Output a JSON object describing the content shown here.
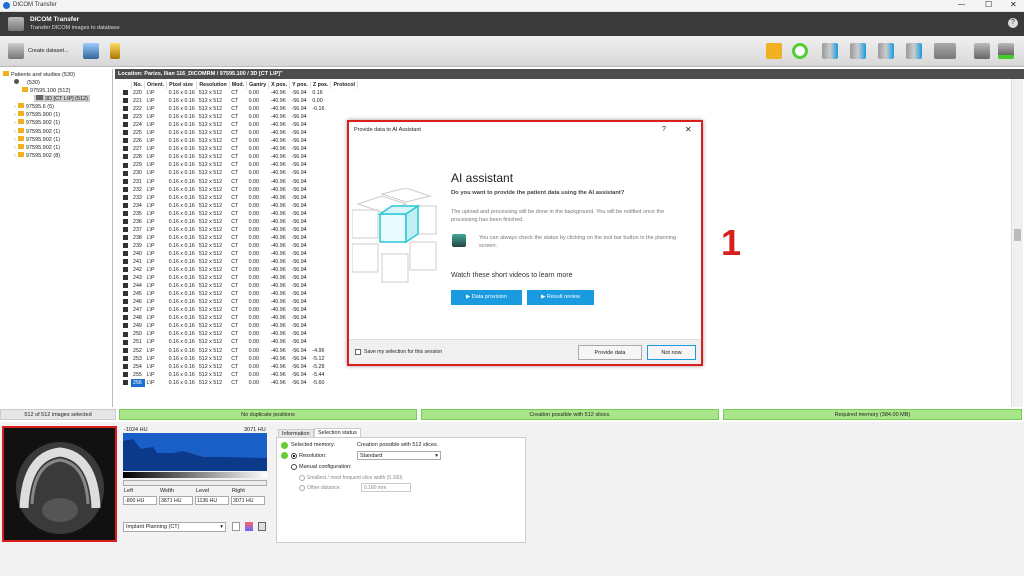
{
  "window": {
    "title": "DICOM Transfer"
  },
  "header": {
    "title": "DICOM Transfer",
    "subtitle": "Transfer DICOM images to database"
  },
  "toolbar": {
    "create_label": "Create dataset..."
  },
  "tree": {
    "root": "Patients and studies (530)",
    "patient": "(530)",
    "study": "97595.100 (512)",
    "series": "3D [CT L\\P] (512)",
    "others": [
      "97595.6 (5)",
      "97595.900 (1)",
      "97595.902 (1)",
      "97595.902 (1)",
      "97595.902 (1)",
      "97595.902 (1)",
      "97595.902 (8)"
    ]
  },
  "location": "Location: Parizo, Ilian 116_DICOMRM / 97595.100 / 3D [CT L\\P]\"",
  "table": {
    "headers": [
      "No.",
      "Orient.",
      "Pixel size",
      "Resolution",
      "Mod.",
      "Gantry",
      "X pos.",
      "Y pos.",
      "Z pos.",
      "Protocol"
    ],
    "rows": [
      [
        "220",
        "L\\P",
        "0.16 x 0.16",
        "512 x 512",
        "CT",
        "0.00",
        "-40.96",
        "-56.94",
        "0.16"
      ],
      [
        "221",
        "L\\P",
        "0.16 x 0.16",
        "512 x 512",
        "CT",
        "0.00",
        "-40.96",
        "-56.94",
        "0.00"
      ],
      [
        "222",
        "L\\P",
        "0.16 x 0.16",
        "512 x 512",
        "CT",
        "0.00",
        "-40.96",
        "-56.94",
        "-0.16"
      ],
      [
        "223",
        "L\\P",
        "0.16 x 0.16",
        "512 x 512",
        "CT",
        "0.00",
        "-40.96",
        "-56.94",
        ""
      ],
      [
        "224",
        "L\\P",
        "0.16 x 0.16",
        "512 x 512",
        "CT",
        "0.00",
        "-40.96",
        "-56.94",
        ""
      ],
      [
        "225",
        "L\\P",
        "0.16 x 0.16",
        "512 x 512",
        "CT",
        "0.00",
        "-40.96",
        "-56.94",
        ""
      ],
      [
        "226",
        "L\\P",
        "0.16 x 0.16",
        "512 x 512",
        "CT",
        "0.00",
        "-40.96",
        "-56.94",
        ""
      ],
      [
        "227",
        "L\\P",
        "0.16 x 0.16",
        "512 x 512",
        "CT",
        "0.00",
        "-40.96",
        "-56.94",
        ""
      ],
      [
        "228",
        "L\\P",
        "0.16 x 0.16",
        "512 x 512",
        "CT",
        "0.00",
        "-40.96",
        "-56.94",
        ""
      ],
      [
        "229",
        "L\\P",
        "0.16 x 0.16",
        "512 x 512",
        "CT",
        "0.00",
        "-40.96",
        "-56.94",
        ""
      ],
      [
        "230",
        "L\\P",
        "0.16 x 0.16",
        "512 x 512",
        "CT",
        "0.00",
        "-40.96",
        "-56.94",
        ""
      ],
      [
        "231",
        "L\\P",
        "0.16 x 0.16",
        "512 x 512",
        "CT",
        "0.00",
        "-40.96",
        "-56.94",
        ""
      ],
      [
        "232",
        "L\\P",
        "0.16 x 0.16",
        "512 x 512",
        "CT",
        "0.00",
        "-40.96",
        "-56.94",
        ""
      ],
      [
        "233",
        "L\\P",
        "0.16 x 0.16",
        "512 x 512",
        "CT",
        "0.00",
        "-40.96",
        "-56.94",
        ""
      ],
      [
        "234",
        "L\\P",
        "0.16 x 0.16",
        "512 x 512",
        "CT",
        "0.00",
        "-40.96",
        "-56.94",
        ""
      ],
      [
        "235",
        "L\\P",
        "0.16 x 0.16",
        "512 x 512",
        "CT",
        "0.00",
        "-40.96",
        "-56.94",
        ""
      ],
      [
        "236",
        "L\\P",
        "0.16 x 0.16",
        "512 x 512",
        "CT",
        "0.00",
        "-40.96",
        "-56.94",
        ""
      ],
      [
        "237",
        "L\\P",
        "0.16 x 0.16",
        "512 x 512",
        "CT",
        "0.00",
        "-40.96",
        "-56.94",
        ""
      ],
      [
        "238",
        "L\\P",
        "0.16 x 0.16",
        "512 x 512",
        "CT",
        "0.00",
        "-40.96",
        "-56.94",
        ""
      ],
      [
        "239",
        "L\\P",
        "0.16 x 0.16",
        "512 x 512",
        "CT",
        "0.00",
        "-40.96",
        "-56.94",
        ""
      ],
      [
        "240",
        "L\\P",
        "0.16 x 0.16",
        "512 x 512",
        "CT",
        "0.00",
        "-40.96",
        "-56.94",
        ""
      ],
      [
        "241",
        "L\\P",
        "0.16 x 0.16",
        "512 x 512",
        "CT",
        "0.00",
        "-40.96",
        "-56.94",
        ""
      ],
      [
        "242",
        "L\\P",
        "0.16 x 0.16",
        "512 x 512",
        "CT",
        "0.00",
        "-40.96",
        "-56.94",
        ""
      ],
      [
        "243",
        "L\\P",
        "0.16 x 0.16",
        "512 x 512",
        "CT",
        "0.00",
        "-40.96",
        "-56.94",
        ""
      ],
      [
        "244",
        "L\\P",
        "0.16 x 0.16",
        "512 x 512",
        "CT",
        "0.00",
        "-40.96",
        "-56.94",
        ""
      ],
      [
        "245",
        "L\\P",
        "0.16 x 0.16",
        "512 x 512",
        "CT",
        "0.00",
        "-40.96",
        "-56.94",
        ""
      ],
      [
        "246",
        "L\\P",
        "0.16 x 0.16",
        "512 x 512",
        "CT",
        "0.00",
        "-40.96",
        "-56.94",
        ""
      ],
      [
        "247",
        "L\\P",
        "0.16 x 0.16",
        "512 x 512",
        "CT",
        "0.00",
        "-40.96",
        "-56.94",
        ""
      ],
      [
        "248",
        "L\\P",
        "0.16 x 0.16",
        "512 x 512",
        "CT",
        "0.00",
        "-40.96",
        "-56.94",
        ""
      ],
      [
        "249",
        "L\\P",
        "0.16 x 0.16",
        "512 x 512",
        "CT",
        "0.00",
        "-40.96",
        "-56.94",
        ""
      ],
      [
        "250",
        "L\\P",
        "0.16 x 0.16",
        "512 x 512",
        "CT",
        "0.00",
        "-40.96",
        "-56.94",
        ""
      ],
      [
        "251",
        "L\\P",
        "0.16 x 0.16",
        "512 x 512",
        "CT",
        "0.00",
        "-40.96",
        "-56.94",
        ""
      ],
      [
        "252",
        "L\\P",
        "0.16 x 0.16",
        "512 x 512",
        "CT",
        "0.00",
        "-40.96",
        "-56.94",
        "-4.96"
      ],
      [
        "253",
        "L\\P",
        "0.16 x 0.16",
        "512 x 512",
        "CT",
        "0.00",
        "-40.96",
        "-56.94",
        "-5.12"
      ],
      [
        "254",
        "L\\P",
        "0.16 x 0.16",
        "512 x 512",
        "CT",
        "0.00",
        "-40.96",
        "-56.94",
        "-5.28"
      ],
      [
        "255",
        "L\\P",
        "0.16 x 0.16",
        "512 x 512",
        "CT",
        "0.00",
        "-40.96",
        "-56.94",
        "-5.44"
      ],
      [
        "256",
        "L\\P",
        "0.16 x 0.16",
        "512 x 512",
        "CT",
        "0.00",
        "-40.96",
        "-56.94",
        "-5.60"
      ]
    ]
  },
  "status": {
    "selected": "512 of 512 images selected",
    "duplicates": "No duplicate positions",
    "creation": "Creation possible with 512 slices.",
    "memory": "Required memory (384.00 MB)"
  },
  "histogram": {
    "min": "-1024 HU",
    "max": "3071 HU"
  },
  "window_level": {
    "labels": [
      "Left",
      "Width",
      "Level",
      "Right"
    ],
    "values": [
      "-800 HU",
      "3871 HU",
      "1136 HU",
      "3071 HU"
    ]
  },
  "preset": "Implant Planning (CT)",
  "tabs": [
    "Information",
    "Selection status"
  ],
  "selection": {
    "line1a": "Selected memory:",
    "line1b": "Creation possible with 512 slices.",
    "resolution_label": "Resolution:",
    "resolution_value": "Standard",
    "manual": "Manual configuration:",
    "smallest": "Smallest / most frequent slice width (0.160)",
    "other": "Other distance:",
    "other_value": "0.160 mm"
  },
  "dialog": {
    "title": "Provide data to AI Assistant",
    "help": "?",
    "close": "✕",
    "heading": "AI assistant",
    "question": "Do you want to provide the patient data using the AI assistant?",
    "body": "The upload and processing will be done in the background. You will be notified once the processing has been finished.",
    "tip": "You can always check the status by clicking on the tool bar button in the planning screen.",
    "videos": "Watch these short videos to learn more",
    "video1": "Data provision",
    "video2": "Result review",
    "save_label": "Save my selection for this session",
    "provide": "Provide data",
    "notnow": "Not now"
  },
  "annotation": "1",
  "colors": {
    "accent": "#1a9be0",
    "highlight_red": "#d91e1e",
    "status_green": "#a9e68a"
  }
}
